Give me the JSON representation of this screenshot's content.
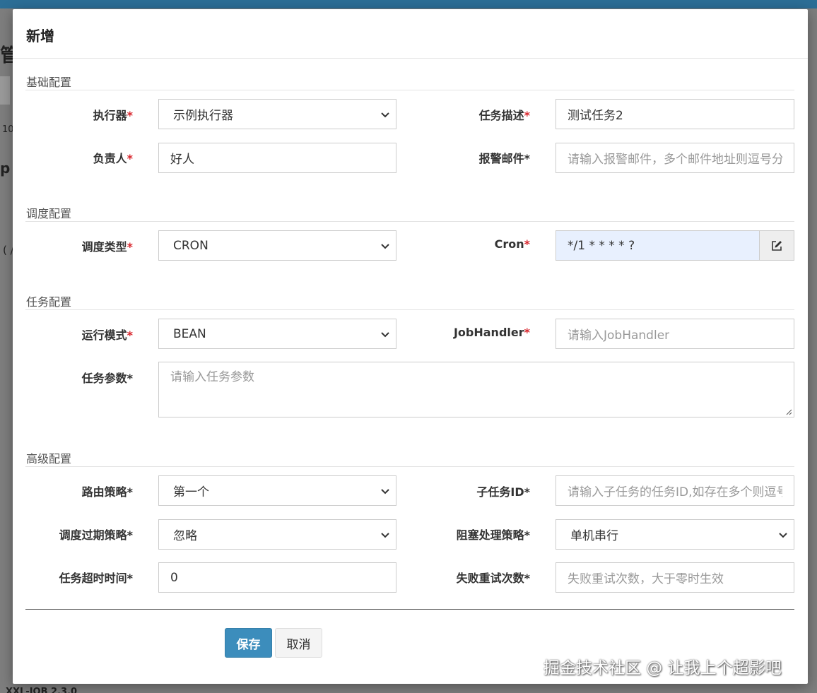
{
  "background": {
    "frag_title": "管",
    "frag_num": "10",
    "frag_p": "p",
    "frag_paren": "( /",
    "frag_footer": "XXL-JOB 2.3.0"
  },
  "modal": {
    "title": "新增",
    "sections": {
      "basic": "基础配置",
      "schedule": "调度配置",
      "task": "任务配置",
      "advanced": "高级配置"
    },
    "fields": {
      "executor": {
        "label": "执行器",
        "value": "示例执行器"
      },
      "job_desc": {
        "label": "任务描述",
        "value": "测试任务2"
      },
      "author": {
        "label": "负责人",
        "value": "好人"
      },
      "alarm_email": {
        "label": "报警邮件*",
        "placeholder": "请输入报警邮件，多个邮件地址则逗号分隔"
      },
      "schedule_type": {
        "label": "调度类型",
        "value": "CRON"
      },
      "cron": {
        "label": "Cron",
        "value": "*/1 * * * * ?"
      },
      "run_mode": {
        "label": "运行模式",
        "value": "BEAN"
      },
      "job_handler": {
        "label": "JobHandler",
        "placeholder": "请输入JobHandler"
      },
      "job_param": {
        "label": "任务参数*",
        "placeholder": "请输入任务参数"
      },
      "route_strategy": {
        "label": "路由策略*",
        "value": "第一个"
      },
      "child_job_id": {
        "label": "子任务ID*",
        "placeholder": "请输入子任务的任务ID,如存在多个则逗号分隔"
      },
      "misfire_strategy": {
        "label": "调度过期策略*",
        "value": "忽略"
      },
      "block_strategy": {
        "label": "阻塞处理策略*",
        "value": "单机串行"
      },
      "timeout": {
        "label": "任务超时时间*",
        "value": "0"
      },
      "fail_retry": {
        "label": "失败重试次数*",
        "placeholder": "失败重试次数，大于零时生效"
      }
    },
    "required_star": "*",
    "buttons": {
      "save": "保存",
      "cancel": "取消"
    }
  },
  "watermark": "掘金技术社区 @ 让我上个超影吧",
  "colors": {
    "primary": "#3c8dbc",
    "required": "#d9272e",
    "header_bar": "#2c6e96",
    "autofill": "#e8f0fe"
  },
  "icons": {
    "select_caret": "chevron-down-icon",
    "cron_edit": "edit-icon"
  }
}
